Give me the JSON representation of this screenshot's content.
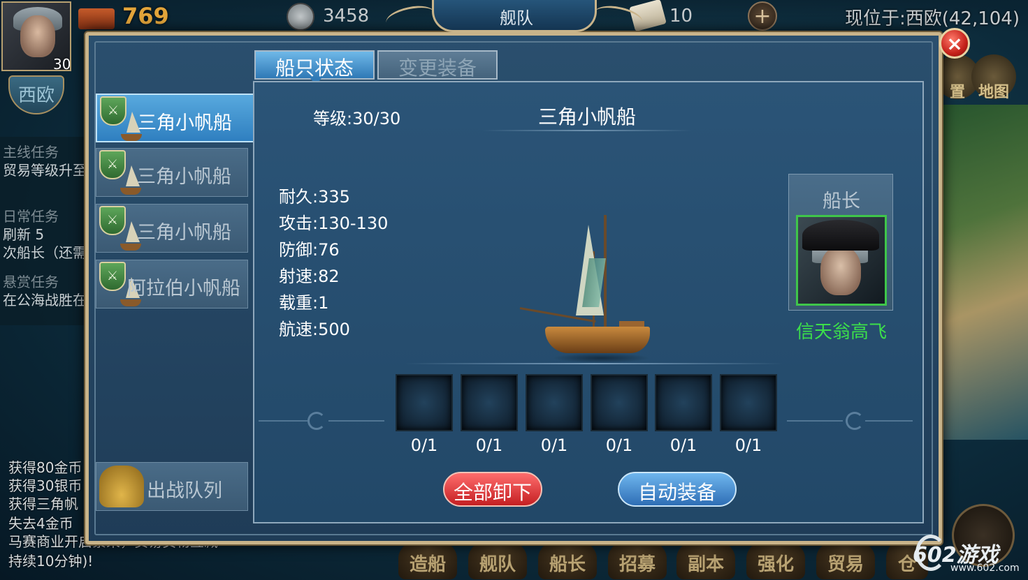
{
  "hud": {
    "player_level": "30",
    "gold": "769",
    "silver": "3458",
    "scrolls": "10",
    "plus_symbol": "+",
    "location": "现位于:西欧(42,104)",
    "region": "西欧"
  },
  "quests": [
    {
      "head": "主线任务",
      "text": "贸易等级升至"
    },
    {
      "head": "日常任务",
      "text": "刷新 5"
    },
    {
      "head": "",
      "text": "次船长（还需"
    },
    {
      "head": "悬赏任务",
      "text": "在公海战胜在"
    }
  ],
  "log": [
    "获得80金币",
    "获得30银币",
    "获得三角帆",
    "失去4金币",
    "马赛商业开启繁荣，贸易货物互减",
    "持续10分钟)!"
  ],
  "bottom_menu": [
    "造船",
    "舰队",
    "船长",
    "招募",
    "副本",
    "强化",
    "贸易",
    "仓"
  ],
  "right_menu": [
    "置",
    "地图"
  ],
  "dialog": {
    "title": "舰队",
    "close_symbol": "×",
    "tabs": {
      "status": "船只状态",
      "equip": "变更装备"
    },
    "ship_list": [
      {
        "name": "三角小帆船",
        "active": true
      },
      {
        "name": "三角小帆船",
        "active": false
      },
      {
        "name": "三角小帆船",
        "active": false
      },
      {
        "name": "阿拉伯小帆船",
        "active": false
      }
    ],
    "shield_symbol": "⚔",
    "fleet_button": "出战队列",
    "ship": {
      "level": "等级:30/30",
      "name": "三角小帆船",
      "stats": {
        "durability": "耐久:335",
        "attack": "攻击:130-130",
        "defense": "防御:76",
        "fire_rate": "射速:82",
        "cargo": "载重:1",
        "speed": "航速:500"
      }
    },
    "captain": {
      "label": "船长",
      "name": "信天翁高飞",
      "name_color": "#3ce04a"
    },
    "equip_slots": [
      "0/1",
      "0/1",
      "0/1",
      "0/1",
      "0/1",
      "0/1"
    ],
    "buttons": {
      "unequip_all": "全部卸下",
      "auto_equip": "自动装备"
    }
  },
  "watermark": {
    "brand": "602游戏",
    "url": "www.602.com"
  }
}
